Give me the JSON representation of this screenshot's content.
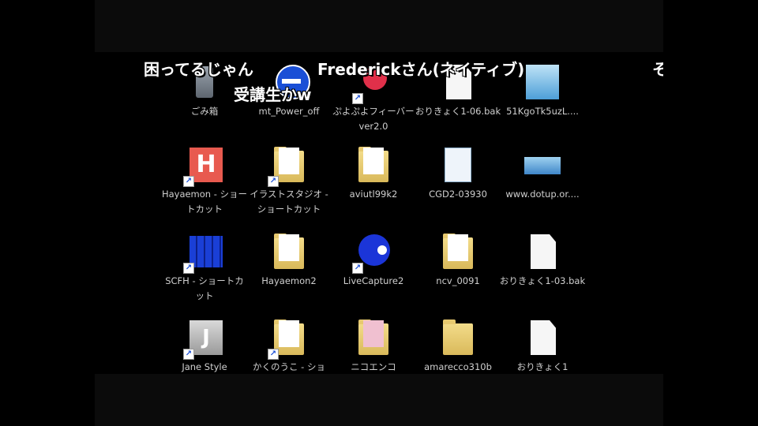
{
  "desktop": {
    "row1": [
      "ごみ箱",
      "mt_Power_off",
      "ぷよぷよフィーバー ver2.0",
      "おりきょく1-06.bak",
      "51KgoTk5uzL...."
    ],
    "row2": [
      "Hayaemon - ショートカット",
      "イラストスタジオ - ショートカット",
      "aviutl99k2",
      "CGD2-03930",
      "www.dotup.or...."
    ],
    "row3": [
      "SCFH - ショートカット",
      "Hayaemon2",
      "LiveCapture2",
      "ncv_0091",
      "おりきょく1-03.bak"
    ],
    "row4": [
      "Jane Style",
      "かくのうこ - ショ",
      "ニコエンコ",
      "amarecco310b",
      "おりきょく1"
    ]
  },
  "comments": {
    "c1": "困ってるじゃん",
    "c2": "Frederickさん(ネイティブ)",
    "c3": "受講生かw",
    "c4": "そ"
  },
  "colors": {
    "background": "#000000",
    "label": "#cfcfcf",
    "accent_blue": "#1a4fd6"
  }
}
